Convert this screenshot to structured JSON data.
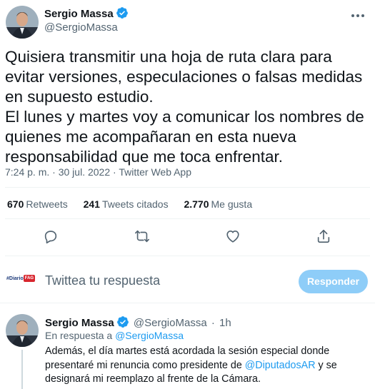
{
  "tweet": {
    "author": {
      "name": "Sergio Massa",
      "handle": "@SergioMassa"
    },
    "text": "Quisiera transmitir una hoja de ruta clara para evitar versiones, especulaciones o falsas medidas en supuesto estudio.\nEl lunes y martes voy a comunicar los nombres de quienes me acompañaran en esta nueva responsabilidad que me toca enfrentar.",
    "time": "7:24 p. m.",
    "separator": "·",
    "date": "30 jul. 2022",
    "source": "Twitter Web App",
    "stats": {
      "retweets_count": "670",
      "retweets_label": "Retweets",
      "quotes_count": "241",
      "quotes_label": "Tweets citados",
      "likes_count": "2.770",
      "likes_label": "Me gusta"
    },
    "actions": [
      "reply-icon",
      "retweet-icon",
      "like-icon",
      "share-icon"
    ]
  },
  "reply_box": {
    "avatar_text": "#Diario",
    "avatar_tag": "FAG",
    "placeholder": "Twittea tu respuesta",
    "button_label": "Responder"
  },
  "reply": {
    "name": "Sergio Massa",
    "handle": "@SergioMassa",
    "separator": "·",
    "time": "1h",
    "replying_prefix": "En respuesta a",
    "replying_to": "@SergioMassa",
    "text_part1": "Además, el día martes está acordada la sesión especial donde presentaré mi renuncia como presidente de",
    "mention": "@DiputadosAR",
    "text_part2": "y se designará mi reemplazo al frente de la Cámara."
  },
  "colors": {
    "accent": "#1d9bf0",
    "verified": "#1d9bf0",
    "button_disabled": "#8ecdf8",
    "secondary_text": "#536471"
  }
}
